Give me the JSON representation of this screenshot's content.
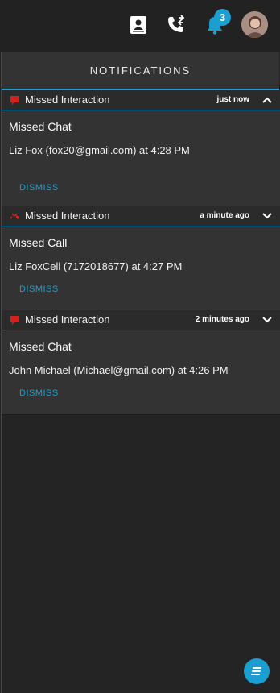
{
  "header": {
    "notification_count": "3",
    "icons": [
      "contacts-icon",
      "transfer-call-icon",
      "bell-icon",
      "user-avatar"
    ]
  },
  "panel": {
    "title": "NOTIFICATIONS"
  },
  "notifications": [
    {
      "type_icon": "chat-icon",
      "title": "Missed Interaction",
      "time": "just now",
      "expanded": true,
      "kind": "Missed Chat",
      "detail": "Liz Fox (fox20@gmail.com) at 4:28 PM",
      "dismiss_label": "DISMISS"
    },
    {
      "type_icon": "missed-call-icon",
      "title": "Missed Interaction",
      "time": "a minute ago",
      "expanded": false,
      "kind": "Missed Call",
      "detail": "Liz FoxCell (7172018677) at 4:27 PM",
      "dismiss_label": "DISMISS"
    },
    {
      "type_icon": "chat-icon",
      "title": "Missed Interaction",
      "time": "2 minutes ago",
      "expanded": false,
      "kind": "Missed Chat",
      "detail": "John Michael (Michael@gmail.com) at 4:26 PM",
      "dismiss_label": "DISMISS"
    }
  ],
  "colors": {
    "accent": "#1a9fd0",
    "missed": "#d42020",
    "background": "#242424",
    "card": "#333333"
  }
}
